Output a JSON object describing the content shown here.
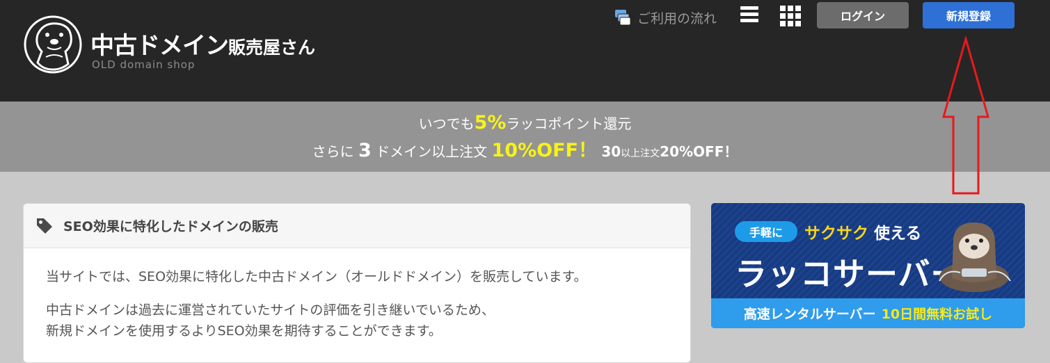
{
  "header": {
    "logo_title": "中古ドメイン",
    "logo_title_suffix": "販売屋さん",
    "logo_subtitle": "OLD domain shop",
    "flow_link": "ご利用の流れ",
    "login_label": "ログイン",
    "register_label": "新規登録"
  },
  "promo": {
    "line1_prefix": "いつでも",
    "line1_highlight": "5%",
    "line1_suffix": "ラッコポイント還元",
    "line2_prefix": "さらに",
    "line2_count": "3",
    "line2_mid": "ドメイン以上注文",
    "line2_highlight": "10%OFF！",
    "line2_count2": "30",
    "line2_small": "以上注文",
    "line2_tail": "20%OFF！"
  },
  "main_card": {
    "title": "SEO効果に特化したドメインの販売",
    "paragraphs": [
      "当サイトでは、SEO効果に特化した中古ドメイン（オールドドメイン）を販売しています。",
      "中古ドメインは過去に運営されていたサイトの評価を引き継いでいるため、",
      "新規ドメインを使用するよりSEO効果を期待することができます。"
    ]
  },
  "banner": {
    "pill": "手軽に",
    "tagline_highlight": "サクサク",
    "tagline_rest": "使える",
    "name": "ラッコサーバー",
    "bottom_text": "高速レンタルサーバー",
    "bottom_highlight": "10日間無料お試し"
  },
  "colors": {
    "header_bg": "#262626",
    "promo_bg": "#949494",
    "highlight_yellow": "#f7f21a",
    "register_blue": "#2e70d6",
    "login_gray": "#6c6c6c",
    "annotation_red": "#e8191c"
  },
  "icons": {
    "flow": "flow-cards-icon",
    "menu": "hamburger-icon",
    "apps": "grid-icon",
    "title_tag": "tag-icon",
    "logo": "otter-logo-icon"
  }
}
